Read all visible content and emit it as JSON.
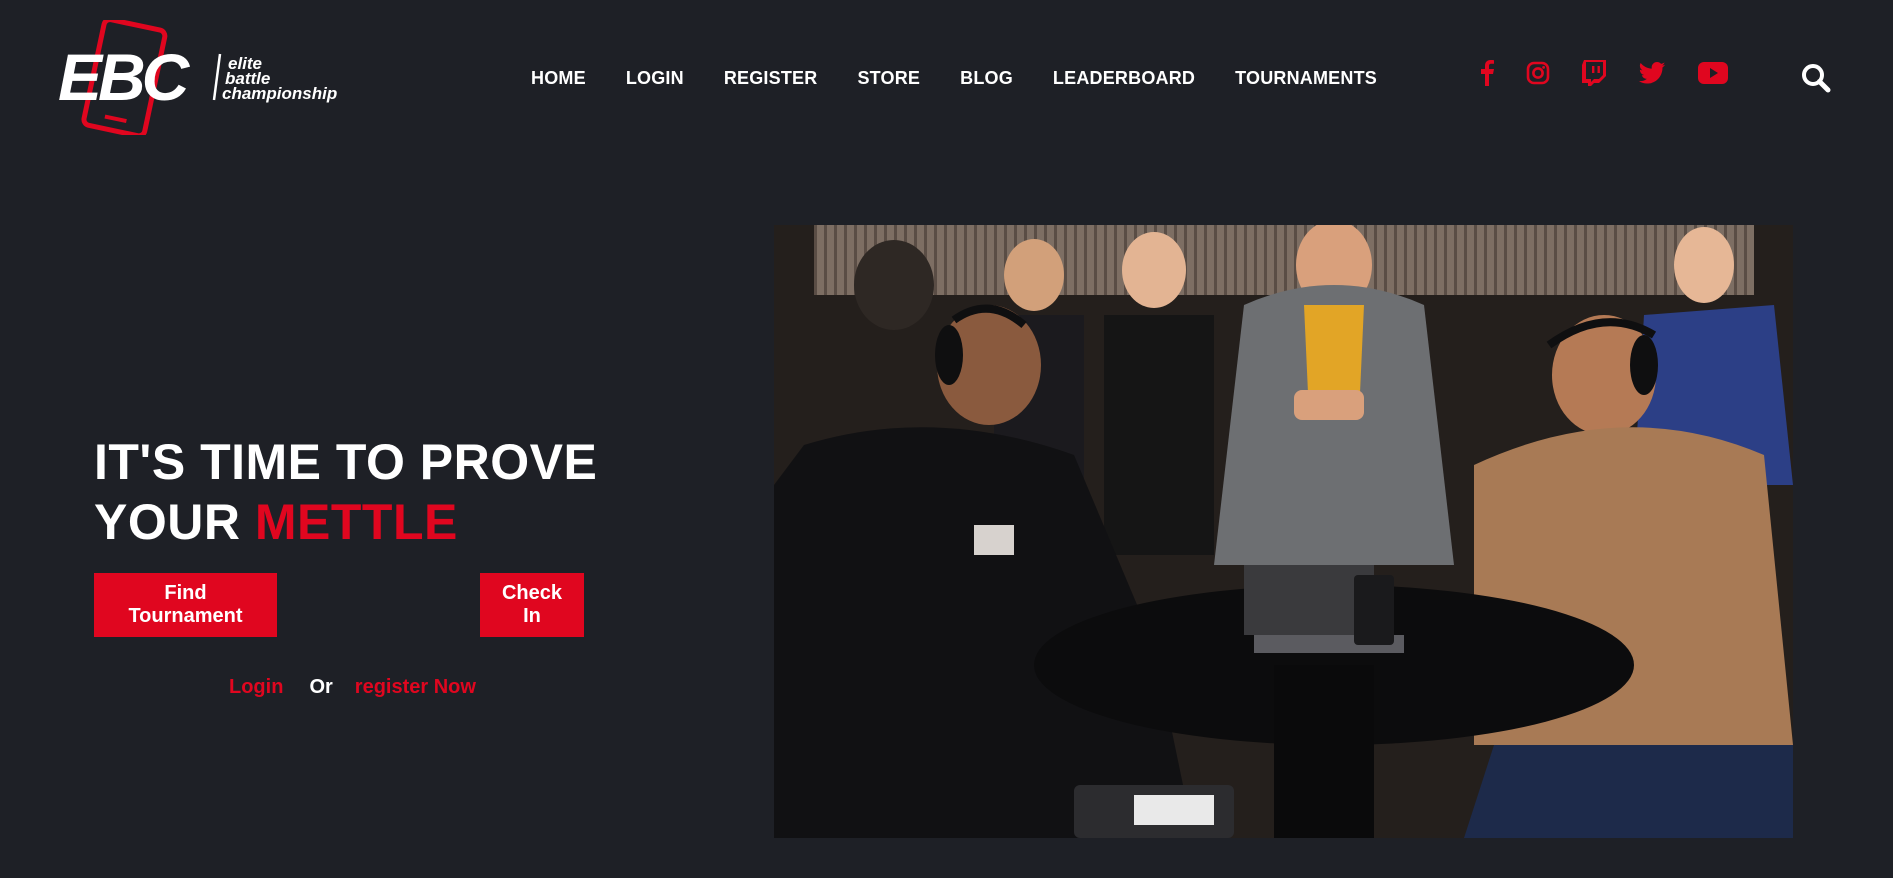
{
  "brand": {
    "logo_mark": "EBC",
    "logo_line1": "elite",
    "logo_line2": "battle",
    "logo_line3": "championship",
    "accent_color": "#e0061f",
    "background_color": "#1e2026"
  },
  "nav": {
    "items": [
      {
        "label": "HOME"
      },
      {
        "label": "LOGIN"
      },
      {
        "label": "REGISTER"
      },
      {
        "label": "STORE"
      },
      {
        "label": "BLOG"
      },
      {
        "label": "LEADERBOARD"
      },
      {
        "label": "TOURNAMENTS"
      }
    ]
  },
  "social": {
    "icons": [
      "facebook-icon",
      "instagram-icon",
      "twitch-icon",
      "twitter-icon",
      "youtube-icon"
    ],
    "search_icon": "search-icon"
  },
  "hero": {
    "headline_line1": "IT'S TIME TO PROVE",
    "headline_line2_prefix": "YOUR",
    "headline_line2_accent": "METTLE",
    "find_button": "Find Tournament",
    "checkin_button": "Check In",
    "login_link": "Login",
    "or_text": "Or",
    "register_link": "register Now"
  }
}
